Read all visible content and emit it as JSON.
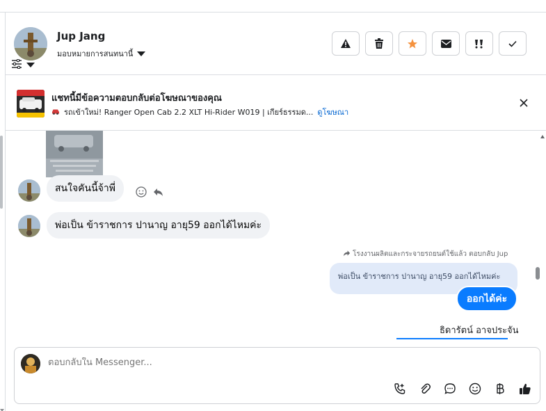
{
  "header": {
    "contact_name": "Jup Jang",
    "assign_label": "มอบหมายการสนทนานี้",
    "actions": [
      {
        "name": "report-button",
        "icon": "warning-icon"
      },
      {
        "name": "delete-button",
        "icon": "trash-icon"
      },
      {
        "name": "star-button",
        "icon": "star-icon"
      },
      {
        "name": "mark-unread-button",
        "icon": "envelope-icon"
      },
      {
        "name": "spam-button",
        "icon": "spam-icon"
      },
      {
        "name": "mark-done-button",
        "icon": "check-icon"
      }
    ]
  },
  "ad_banner": {
    "title": "แชทนี้มีข้อความตอบกลับต่อโฆษณาของคุณ",
    "subtitle": "รถเข้าใหม่! Ranger Open Cab 2.2 XLT Hi-Rider W019 | เกียร์ธรรมด...",
    "link": "ดูโฆษณา"
  },
  "messages": {
    "incoming_1": "สนใจคันนี้จ้าพี่",
    "incoming_2": "พ่อเป็น ข้าราชการ ปานาญ อายุ59 ออกได้ไหมค่ะ",
    "reply_note": "โรงงานผลิตและกระจายรถยนต์ใช้แล้ว ตอบกลับ Jup",
    "quoted": "พ่อเป็น ข้าราชการ ปานาญ อายุ59 ออกได้ไหมค่ะ",
    "outgoing": "ออกได้ค่ะ",
    "sender_name": "ธิดารัตน์ อาจประจัน"
  },
  "composer": {
    "placeholder": "ตอบกลับใน Messenger..."
  },
  "colors": {
    "accent": "#0a7cff",
    "star": "#f5923e",
    "link": "#0064d1"
  }
}
